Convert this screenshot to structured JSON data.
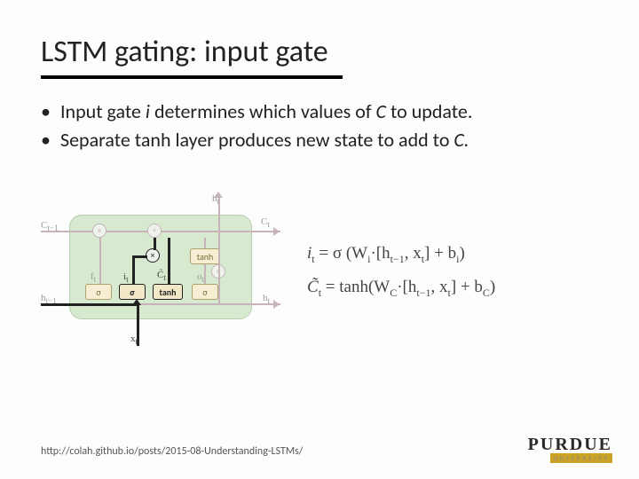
{
  "title": "LSTM gating: input gate",
  "bullets": [
    {
      "pre": "Input gate ",
      "it1": "i",
      "mid": " determines which values of ",
      "it2": "C",
      "post": " to update."
    },
    {
      "pre": "Separate tanh layer produces new state to add to ",
      "it1": "C.",
      "mid": "",
      "it2": "",
      "post": ""
    }
  ],
  "diagram": {
    "labels": {
      "c_prev": "C",
      "c_prev_sub": "t−1",
      "c_next": "C",
      "c_next_sub": "t",
      "h_prev": "h",
      "h_prev_sub": "t−1",
      "h_next": "h",
      "h_next_sub": "t",
      "h_top": "h",
      "h_top_sub": "t",
      "x_in": "x",
      "x_in_sub": "t",
      "f": "f",
      "f_sub": "t",
      "i": "i",
      "i_sub": "t",
      "ctilde": "C̃",
      "ctilde_sub": "t",
      "o": "o",
      "o_sub": "t"
    },
    "ops": {
      "sigma": "σ",
      "tanh": "tanh",
      "times": "×",
      "plus": "+"
    }
  },
  "equations": {
    "line1": {
      "lhs_var": "i",
      "lhs_sub": "t",
      "rhs": " = σ (W",
      "w_sub": "i",
      "mid": "·[h",
      "h_sub": "t−1",
      "mid2": ", x",
      "x_sub": "t",
      "mid3": "]  +  b",
      "b_sub": "i",
      "end": ")"
    },
    "line2": {
      "lhs_var": "C̃",
      "lhs_sub": "t",
      "rhs": " = tanh(W",
      "w_sub": "C",
      "mid": "·[h",
      "h_sub": "t−1",
      "mid2": ", x",
      "x_sub": "t",
      "mid3": "]  +  b",
      "b_sub": "C",
      "end": ")"
    }
  },
  "citation": "http://colah.github.io/posts/2015-08-Understanding-LSTMs/",
  "logo": {
    "name": "PURDUE",
    "sub": "UNIVERSITY"
  }
}
